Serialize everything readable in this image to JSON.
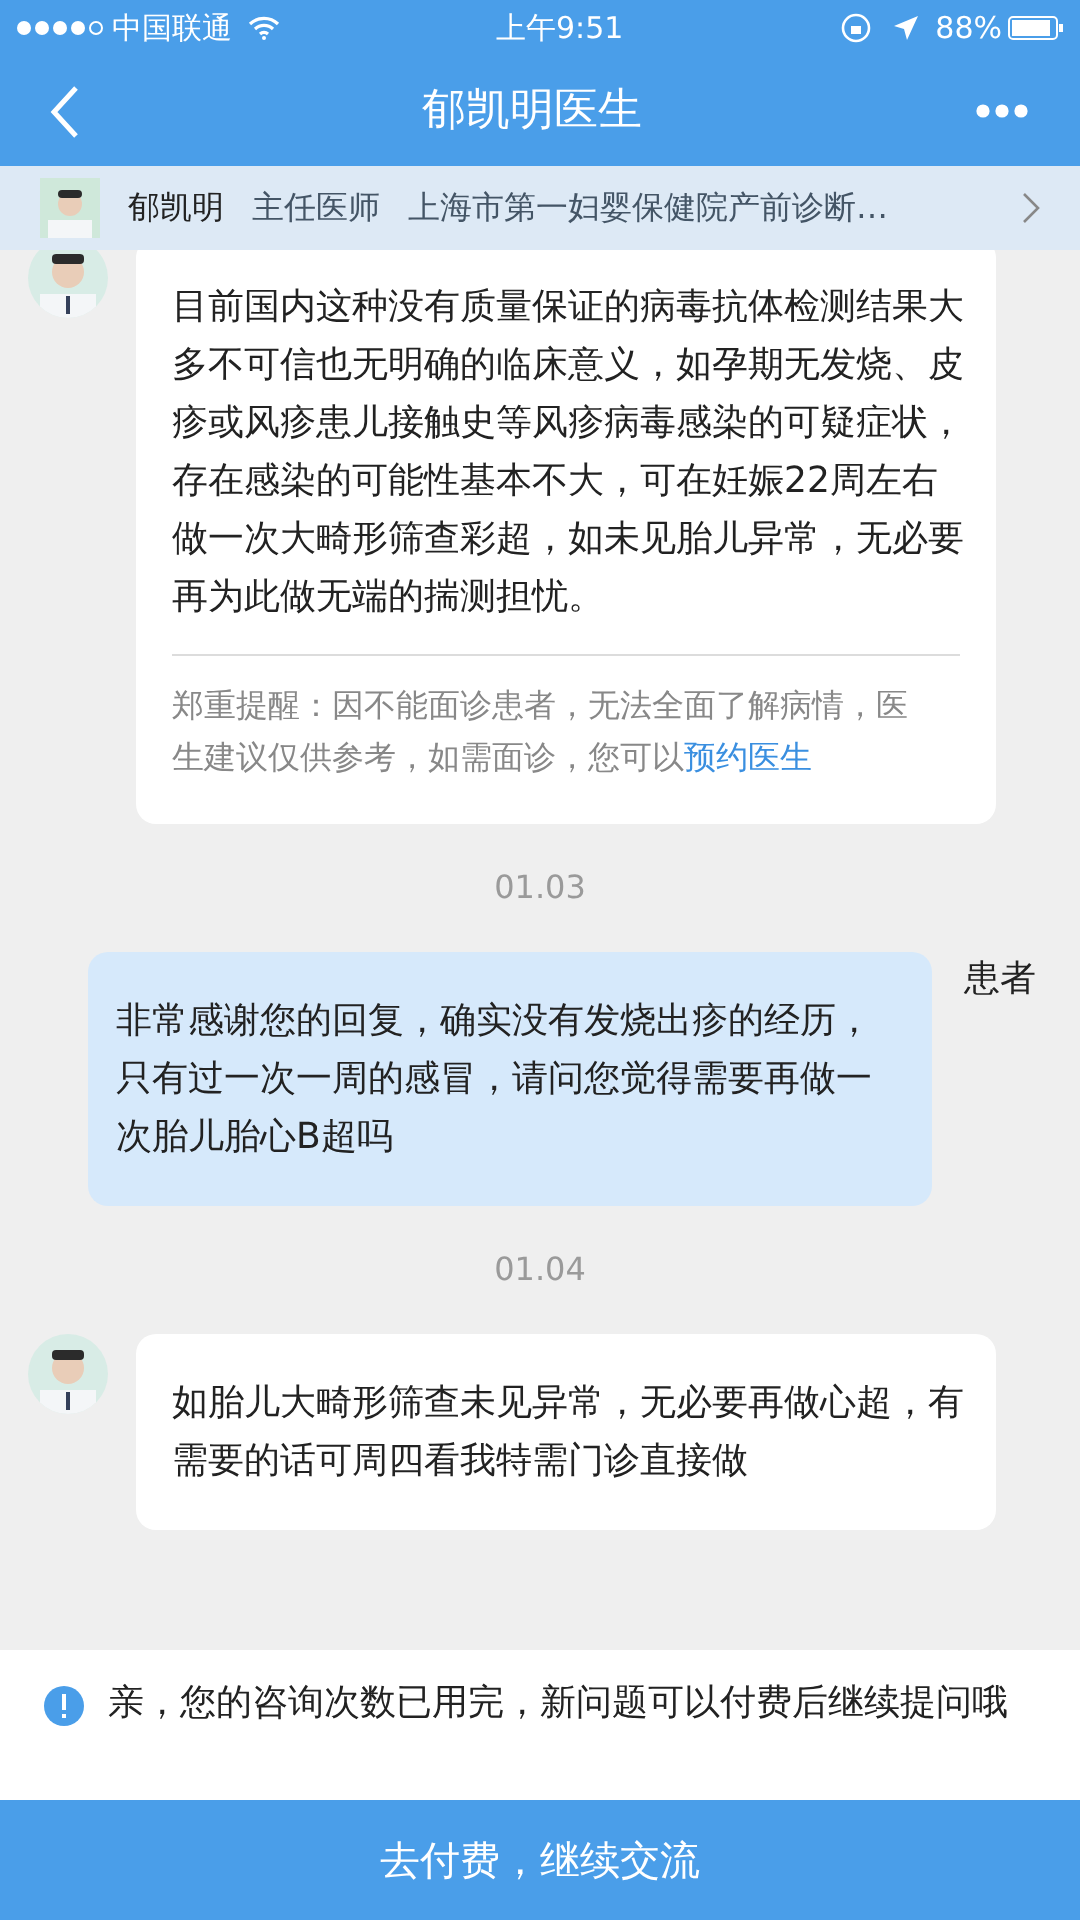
{
  "status_bar": {
    "carrier": "中国联通",
    "time": "上午9:51",
    "battery": "88%"
  },
  "nav": {
    "title": "郁凯明医生"
  },
  "doctor_bar": {
    "name": "郁凯明",
    "title": "主任医师",
    "hospital": "上海市第一妇婴保健院产前诊断…"
  },
  "messages": [
    {
      "kind": "doctor",
      "text": "目前国内这种没有质量保证的病毒抗体检测结果大多不可信也无明确的临床意义，如孕期无发烧、皮疹或风疹患儿接触史等风疹病毒感染的可疑症状，存在感染的可能性基本不大，可在妊娠22周左右做一次大畸形筛查彩超，如未见胎儿异常，无必要再为此做无端的揣测担忧。",
      "notice": {
        "text": "郑重提醒：因不能面诊患者，无法全面了解病情，医生建议仅供参考，如需面诊，您可以",
        "link": "预约医生"
      }
    },
    {
      "kind": "date",
      "text": "01.03"
    },
    {
      "kind": "patient",
      "sender": "患者",
      "text": "非常感谢您的回复，确实没有发烧出疹的经历，只有过一次一周的感冒，请问您觉得需要再做一次胎儿胎心B超吗"
    },
    {
      "kind": "date",
      "text": "01.04"
    },
    {
      "kind": "doctor",
      "text": "如胎儿大畸形筛查未见异常，无必要再做心超，有需要的话可周四看我特需门诊直接做"
    }
  ],
  "alert": {
    "text": "亲，您的咨询次数已用完，新问题可以付费后继续提问哦"
  },
  "pay_button": {
    "label": "去付费，继续交流"
  }
}
